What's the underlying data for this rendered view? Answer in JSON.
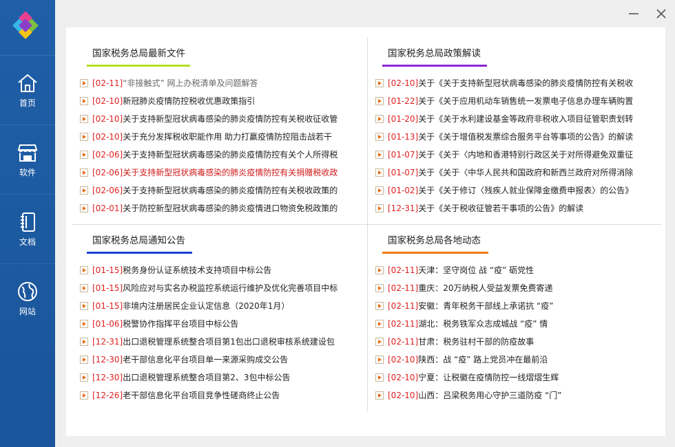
{
  "sidebar": {
    "items": [
      {
        "label": "首页",
        "icon": "home-icon"
      },
      {
        "label": "软件",
        "icon": "store-icon"
      },
      {
        "label": "文档",
        "icon": "notebook-icon"
      },
      {
        "label": "网站",
        "icon": "globe-icon"
      }
    ]
  },
  "window": {
    "minimize_icon": "minimize-icon",
    "close_icon": "close-icon"
  },
  "sections": {
    "latest_files": {
      "title": "国家税务总局最新文件",
      "items": [
        {
          "date": "[02-11]",
          "text": "“非接触式” 网上办税清单及问题解答"
        },
        {
          "date": "[02-10]",
          "text": "新冠肺炎疫情防控税收优惠政策指引"
        },
        {
          "date": "[02-10]",
          "text": "关于支持新型冠状病毒感染的肺炎疫情防控有关税收征收管"
        },
        {
          "date": "[02-10]",
          "text": "关于充分发挥税收职能作用 助力打赢疫情防控阻击战若干"
        },
        {
          "date": "[02-06]",
          "text": "关于支持新型冠状病毒感染的肺炎疫情防控有关个人所得税"
        },
        {
          "date": "[02-06]",
          "text": "关于支持新型冠状病毒感染的肺炎疫情防控有关捐赠税收政"
        },
        {
          "date": "[02-06]",
          "text": "关于支持新型冠状病毒感染的肺炎疫情防控有关税收政策的"
        },
        {
          "date": "[02-01]",
          "text": "关于防控新型冠状病毒感染的肺炎疫情进口物资免税政策的"
        }
      ]
    },
    "policy_interpretation": {
      "title": "国家税务总局政策解读",
      "items": [
        {
          "date": "[02-10]",
          "text": "关于《关于支持新型冠状病毒感染的肺炎疫情防控有关税收"
        },
        {
          "date": "[01-22]",
          "text": "关于《关于应用机动车销售统一发票电子信息办理车辆购置"
        },
        {
          "date": "[01-20]",
          "text": "关于《关于水利建设基金等政府非税收入项目征管职责划转"
        },
        {
          "date": "[01-13]",
          "text": "关于《关于增值税发票综合服务平台等事项的公告》的解读"
        },
        {
          "date": "[01-07]",
          "text": "关于《关于〈内地和香港特别行政区关于对所得避免双重征"
        },
        {
          "date": "[01-07]",
          "text": "关于《关于〈中华人民共和国政府和新西兰政府对所得消除"
        },
        {
          "date": "[01-02]",
          "text": "关于《关于修订〈残疾人就业保障金缴费申报表〉的公告》"
        },
        {
          "date": "[12-31]",
          "text": "关于《关于税收征管若干事项的公告》的解读"
        }
      ]
    },
    "notices": {
      "title": "国家税务总局通知公告",
      "items": [
        {
          "date": "[01-15]",
          "text": "税务身份认证系统技术支持项目中标公告"
        },
        {
          "date": "[01-15]",
          "text": "风险应对与实名办税监控系统运行维护及优化完善项目中标"
        },
        {
          "date": "[01-15]",
          "text": "非境内注册居民企业认定信息（2020年1月）"
        },
        {
          "date": "[01-06]",
          "text": "税警协作指挥平台项目中标公告"
        },
        {
          "date": "[12-31]",
          "text": "出口退税管理系统整合项目第1包出口退税审核系统建设包"
        },
        {
          "date": "[12-30]",
          "text": "老干部信息化平台项目单一来源采购成交公告"
        },
        {
          "date": "[12-30]",
          "text": "出口退税管理系统整合项目第2、3包中标公告"
        },
        {
          "date": "[12-26]",
          "text": "老干部信息化平台项目竞争性磋商终止公告"
        }
      ]
    },
    "local_news": {
      "title": "国家税务总局各地动态",
      "items": [
        {
          "date": "[02-11]",
          "text": "天津：坚守岗位 战 “疫” 砺党性"
        },
        {
          "date": "[02-11]",
          "text": "重庆：20万纳税人受益发票免费寄递"
        },
        {
          "date": "[02-11]",
          "text": "安徽：青年税务干部线上承诺抗 “疫”"
        },
        {
          "date": "[02-11]",
          "text": "湖北：税务铁军众志成城战 “疫” 情"
        },
        {
          "date": "[02-11]",
          "text": "甘肃：税务驻村干部的防疫故事"
        },
        {
          "date": "[02-10]",
          "text": "陕西：战 “疫” 路上党员冲在最前沿"
        },
        {
          "date": "[02-10]",
          "text": "宁夏：让税徽在疫情防控一线熠熠生辉"
        },
        {
          "date": "[02-10]",
          "text": "山西：吕梁税务用心守护三道防疫 “门”"
        }
      ]
    }
  },
  "colors": {
    "sidebar": "#1c5aa0",
    "date": "#e02020",
    "active_link": "#d01818",
    "line_latest": "#b0e020",
    "line_policy": "#8a25d6",
    "line_notice": "#1a40d0",
    "line_local": "#f07a10"
  }
}
